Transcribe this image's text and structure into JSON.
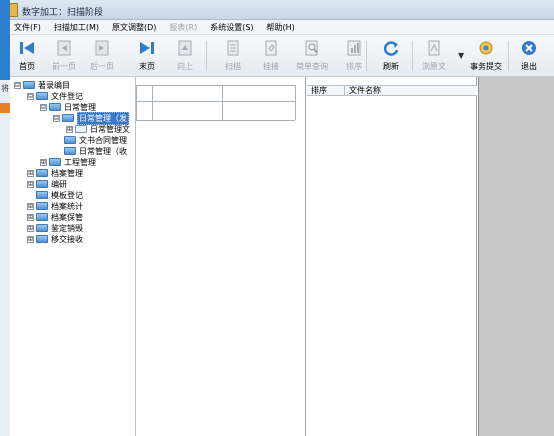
{
  "window": {
    "title": "数字加工：扫描阶段"
  },
  "menu": [
    "文件(F)",
    "扫描加工(M)",
    "原文调整(D)",
    "报表(R)",
    "系统设置(S)",
    "帮助(H)"
  ],
  "toolbar": [
    {
      "label": "首页",
      "icon": "first-page-icon",
      "enabled": true
    },
    {
      "label": "前一页",
      "icon": "prev-page-icon",
      "enabled": false
    },
    {
      "label": "后一页",
      "icon": "next-page-icon",
      "enabled": false
    },
    {
      "label": "末页",
      "icon": "last-page-icon",
      "enabled": true
    },
    {
      "label": "向上",
      "icon": "up-icon",
      "enabled": false
    },
    {
      "label": "扫描",
      "icon": "scan-icon",
      "enabled": false
    },
    {
      "label": "挂接",
      "icon": "attach-icon",
      "enabled": false
    },
    {
      "label": "简单查询",
      "icon": "search-icon",
      "enabled": false
    },
    {
      "label": "排序",
      "icon": "sort-icon",
      "enabled": false
    },
    {
      "label": "刷新",
      "icon": "refresh-icon",
      "enabled": true
    },
    {
      "label": "浏原文",
      "icon": "view-original-icon",
      "enabled": false
    },
    {
      "label": "事务提交",
      "icon": "commit-icon",
      "enabled": true
    },
    {
      "label": "退出",
      "icon": "exit-icon",
      "enabled": true
    }
  ],
  "left_strip": {
    "char": "将"
  },
  "tree": [
    {
      "label": "著录编目",
      "expander": "⊟"
    },
    {
      "label": "文件登记",
      "expander": "⊟"
    },
    {
      "label": "日常管理",
      "expander": "⊟"
    },
    {
      "label": "日常管理（发",
      "expander": "⊟",
      "selected": true
    },
    {
      "label": "日常管理文",
      "expander": "⊞"
    },
    {
      "label": "文书合同管理",
      "expander": ""
    },
    {
      "label": "日常管理（收",
      "expander": ""
    },
    {
      "label": "工程管理",
      "expander": "⊞"
    },
    {
      "label": "档案管理",
      "expander": "⊞"
    },
    {
      "label": "编研",
      "expander": "⊞"
    },
    {
      "label": "模板登记",
      "expander": ""
    },
    {
      "label": "档案统计",
      "expander": "⊞"
    },
    {
      "label": "档案保管",
      "expander": "⊞"
    },
    {
      "label": "鉴定销毁",
      "expander": "⊞"
    },
    {
      "label": "移交接收",
      "expander": "⊞"
    }
  ],
  "file_list": {
    "columns": [
      "排序",
      "文件名称"
    ]
  },
  "colors": {
    "accent": "#3a77c9",
    "strip": "#2e7fd0",
    "preview_bg": "#c8c8c8"
  }
}
